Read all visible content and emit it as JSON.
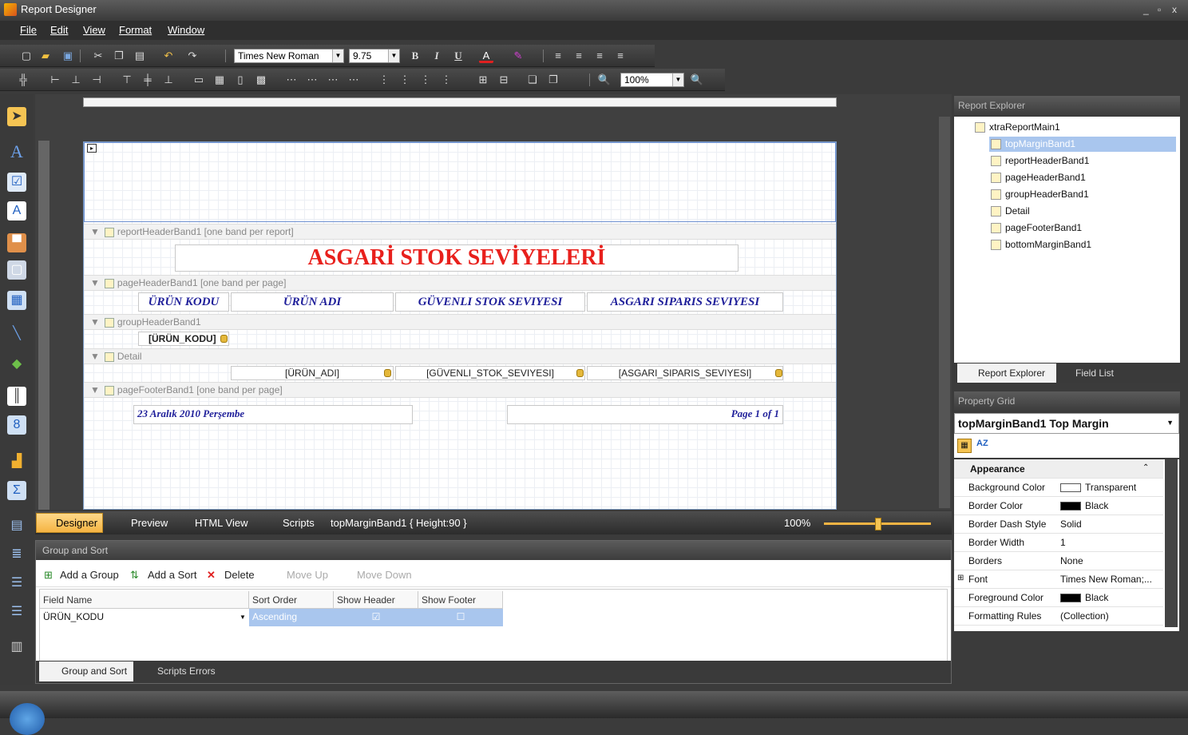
{
  "window": {
    "title": "Report Designer",
    "controls": [
      "_",
      "▫",
      "x"
    ]
  },
  "menu": [
    "File",
    "Edit",
    "View",
    "Format",
    "Window"
  ],
  "toolbar": {
    "font_name": "Times New Roman",
    "font_size": "9.75",
    "zoom": "100%",
    "bold": "B",
    "italic": "I",
    "underline": "U"
  },
  "report": {
    "bands": {
      "report_header": "reportHeaderBand1 [one band per report]",
      "page_header": "pageHeaderBand1 [one band per page]",
      "group_header": "groupHeaderBand1",
      "detail": "Detail",
      "page_footer": "pageFooterBand1 [one band per page]"
    },
    "title": "ASGARİ STOK SEVİYELERİ",
    "columns": [
      "ÜRÜN KODU",
      "ÜRÜN ADI",
      "GÜVENLI STOK SEVIYESI",
      "ASGARI SIPARIS SEVIYESI"
    ],
    "group_field": "[ÜRÜN_KODU]",
    "detail_fields": [
      "[ÜRÜN_ADI]",
      "[GÜVENLI_STOK_SEVIYESI]",
      "[ASGARI_SIPARIS_SEVIYESI]"
    ],
    "footer_date": "23 Aralık 2010 Perşembe",
    "footer_page": "Page 1 of 1"
  },
  "statusbar": {
    "designer": "Designer",
    "preview": "Preview",
    "html_view": "HTML View",
    "scripts": "Scripts",
    "selection": "topMarginBand1 { Height:90 }",
    "zoom": "100%"
  },
  "group_sort": {
    "title": "Group and Sort",
    "toolbar": {
      "add_group": "Add a Group",
      "add_sort": "Add a Sort",
      "delete": "Delete",
      "move_up": "Move Up",
      "move_down": "Move Down"
    },
    "headers": [
      "Field Name",
      "Sort Order",
      "Show Header",
      "Show Footer"
    ],
    "row": {
      "field": "ÜRÜN_KODU",
      "order": "Ascending",
      "show_header": true,
      "show_footer": false
    },
    "tabs": [
      "Group and Sort",
      "Scripts Errors"
    ]
  },
  "report_explorer": {
    "title": "Report Explorer",
    "root": "xtraReportMain1",
    "items": [
      "topMarginBand1",
      "reportHeaderBand1",
      "pageHeaderBand1",
      "groupHeaderBand1",
      "Detail",
      "pageFooterBand1",
      "bottomMarginBand1"
    ],
    "selected": "topMarginBand1",
    "tabs": [
      "Report Explorer",
      "Field List"
    ]
  },
  "property_grid": {
    "title": "Property Grid",
    "object": "topMarginBand1  Top Margin",
    "category": "Appearance",
    "rows": [
      {
        "name": "Background Color",
        "value": "Transparent",
        "swatch": "#ffffff"
      },
      {
        "name": "Border Color",
        "value": "Black",
        "swatch": "#000000"
      },
      {
        "name": "Border Dash Style",
        "value": "Solid"
      },
      {
        "name": "Border Width",
        "value": "1"
      },
      {
        "name": "Borders",
        "value": "None"
      },
      {
        "name": "Font",
        "value": "Times New Roman;..."
      },
      {
        "name": "Foreground Color",
        "value": "Black",
        "swatch": "#000000"
      },
      {
        "name": "Formatting Rules",
        "value": "(Collection)"
      }
    ]
  },
  "colors": {
    "title_red": "#e8201c",
    "header_blue": "#1f1f9a",
    "selection": "#a9c6ee"
  }
}
